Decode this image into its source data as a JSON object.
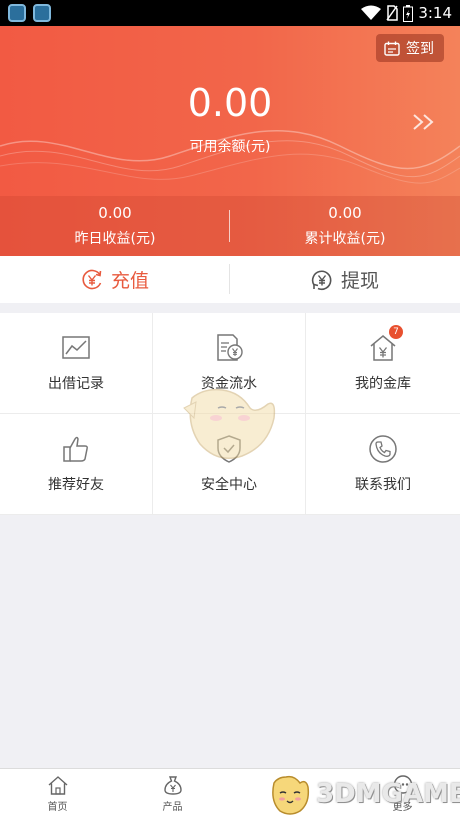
{
  "status_bar": {
    "time": "3:14"
  },
  "header": {
    "checkin_label": "签到",
    "balance_value": "0.00",
    "balance_label": "可用余额(元)",
    "earnings": [
      {
        "value": "0.00",
        "label": "昨日收益(元)"
      },
      {
        "value": "0.00",
        "label": "累计收益(元)"
      }
    ],
    "colors": {
      "accent": "#f25a43",
      "accent_light": "#f4825a"
    }
  },
  "actions": {
    "recharge_label": "充值",
    "withdraw_label": "提现"
  },
  "grid": {
    "items": [
      {
        "label": "出借记录",
        "icon": "chart-icon"
      },
      {
        "label": "资金流水",
        "icon": "document-yen-icon"
      },
      {
        "label": "我的金库",
        "icon": "house-yen-icon",
        "badge": "7"
      },
      {
        "label": "推荐好友",
        "icon": "thumbs-up-icon"
      },
      {
        "label": "安全中心",
        "icon": "shield-icon"
      },
      {
        "label": "联系我们",
        "icon": "phone-icon"
      }
    ]
  },
  "tabbar": {
    "items": [
      {
        "label": "首页",
        "icon": "home-icon"
      },
      {
        "label": "产品",
        "icon": "money-bag-icon"
      },
      {
        "label": "我的",
        "icon": "user-icon",
        "active": true
      },
      {
        "label": "更多",
        "icon": "chat-icon"
      }
    ]
  },
  "watermark": {
    "text": "3DMGAME"
  }
}
